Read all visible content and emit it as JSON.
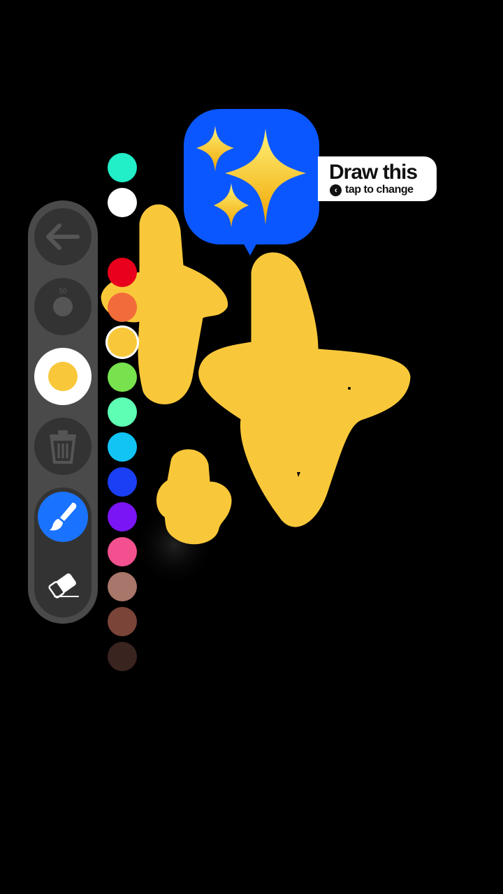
{
  "prompt": {
    "emoji": "✨",
    "title": "Draw this",
    "subtitle": "tap to change",
    "chevron_icon": "chevron-left-icon"
  },
  "toolbar": {
    "size_value": "50",
    "selected_color": "#f9c83a",
    "icons": [
      "back-arrow-icon",
      "brush-size-icon",
      "current-color-icon",
      "trash-icon",
      "brush-icon",
      "eraser-icon"
    ]
  },
  "palette": {
    "colors": [
      "#22eec8",
      "#ffffff",
      "#000000",
      "#e8001c",
      "#f26b3a",
      "#f9c83a",
      "#78e24e",
      "#5effb4",
      "#12c4f4",
      "#1a3ff5",
      "#7a16f5",
      "#f2508e",
      "#a8766a",
      "#7a4438",
      "#3a2420"
    ],
    "selected_index": 5
  },
  "drawing": {
    "stroke_color": "#f9c83a"
  }
}
